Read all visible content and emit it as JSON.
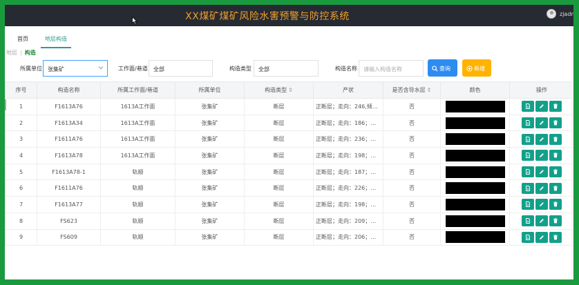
{
  "header": {
    "app_title": "XX煤矿煤矿风险水害预警与防控系统",
    "user_name": "zjadmi"
  },
  "tabs": [
    {
      "label": "首页"
    },
    {
      "label": "地层构造"
    }
  ],
  "breadcrumb": {
    "parent": "地层",
    "current": "构造"
  },
  "filters": {
    "unit_label": "所属单位",
    "unit_value": "张集矿",
    "face_label": "工作面/巷道",
    "face_value": "全部",
    "type_label": "构造类型",
    "type_value": "全部",
    "name_label": "构造名称",
    "name_placeholder": "请输入构造名称",
    "search_button": "查询",
    "add_button": "新增"
  },
  "table": {
    "columns": [
      "序号",
      "构造名称",
      "所属工作面/巷道",
      "所属单位",
      "构造类型",
      "产状",
      "是否含导水层",
      "颜色",
      "操作"
    ],
    "sortable": [
      "构造类型",
      "是否含导水层"
    ],
    "sort_glyph": "⇕",
    "rows": [
      {
        "no": "1",
        "name": "F1613A76",
        "face": "1613A工作面",
        "unit": "张集矿",
        "type": "断层",
        "attitude": "正断层；走向：246,倾向：...",
        "water": "否",
        "color": "#000000"
      },
      {
        "no": "2",
        "name": "F1613A34",
        "face": "1613A工作面",
        "unit": "张集矿",
        "type": "断层",
        "attitude": "正断层；走向：186；倾...",
        "water": "否",
        "color": "#000000"
      },
      {
        "no": "3",
        "name": "F1611A76",
        "face": "1613A工作面",
        "unit": "张集矿",
        "type": "断层",
        "attitude": "正断层；走向：236；倾...",
        "water": "否",
        "color": "#000000"
      },
      {
        "no": "4",
        "name": "F1613A78",
        "face": "1613A工作面",
        "unit": "张集矿",
        "type": "断层",
        "attitude": "正断层；走向：198；倾...",
        "water": "否",
        "color": "#000000"
      },
      {
        "no": "5",
        "name": "F1613A78-1",
        "face": "轨顺",
        "unit": "张集矿",
        "type": "断层",
        "attitude": "正断层；走向：187；倾...",
        "water": "否",
        "color": "#000000"
      },
      {
        "no": "6",
        "name": "F1611A76",
        "face": "轨顺",
        "unit": "张集矿",
        "type": "断层",
        "attitude": "正断层；走向：226；倾...",
        "water": "否",
        "color": "#000000"
      },
      {
        "no": "7",
        "name": "F1613A77",
        "face": "轨顺",
        "unit": "张集矿",
        "type": "断层",
        "attitude": "正断层；走向：198；倾...",
        "water": "否",
        "color": "#000000"
      },
      {
        "no": "8",
        "name": "FS623",
        "face": "轨顺",
        "unit": "张集矿",
        "type": "断层",
        "attitude": "正断层；走向：209；倾...",
        "water": "否",
        "color": "#000000"
      },
      {
        "no": "9",
        "name": "FS609",
        "face": "轨顺",
        "unit": "张集矿",
        "type": "断层",
        "attitude": "正断层；走向：206；倾...",
        "water": "否",
        "color": "#000000"
      }
    ],
    "actions": [
      {
        "name": "view-button",
        "icon": "document-icon"
      },
      {
        "name": "edit-button",
        "icon": "pencil-icon"
      },
      {
        "name": "delete-button",
        "icon": "trash-icon"
      }
    ]
  },
  "colors": {
    "header_bg": "#262a33",
    "title": "#f0a028",
    "accent": "#2b9a93",
    "search": "#2d8cf0",
    "add": "#ffb300",
    "action": "#13a08a",
    "frame": "#1a9a3e"
  }
}
